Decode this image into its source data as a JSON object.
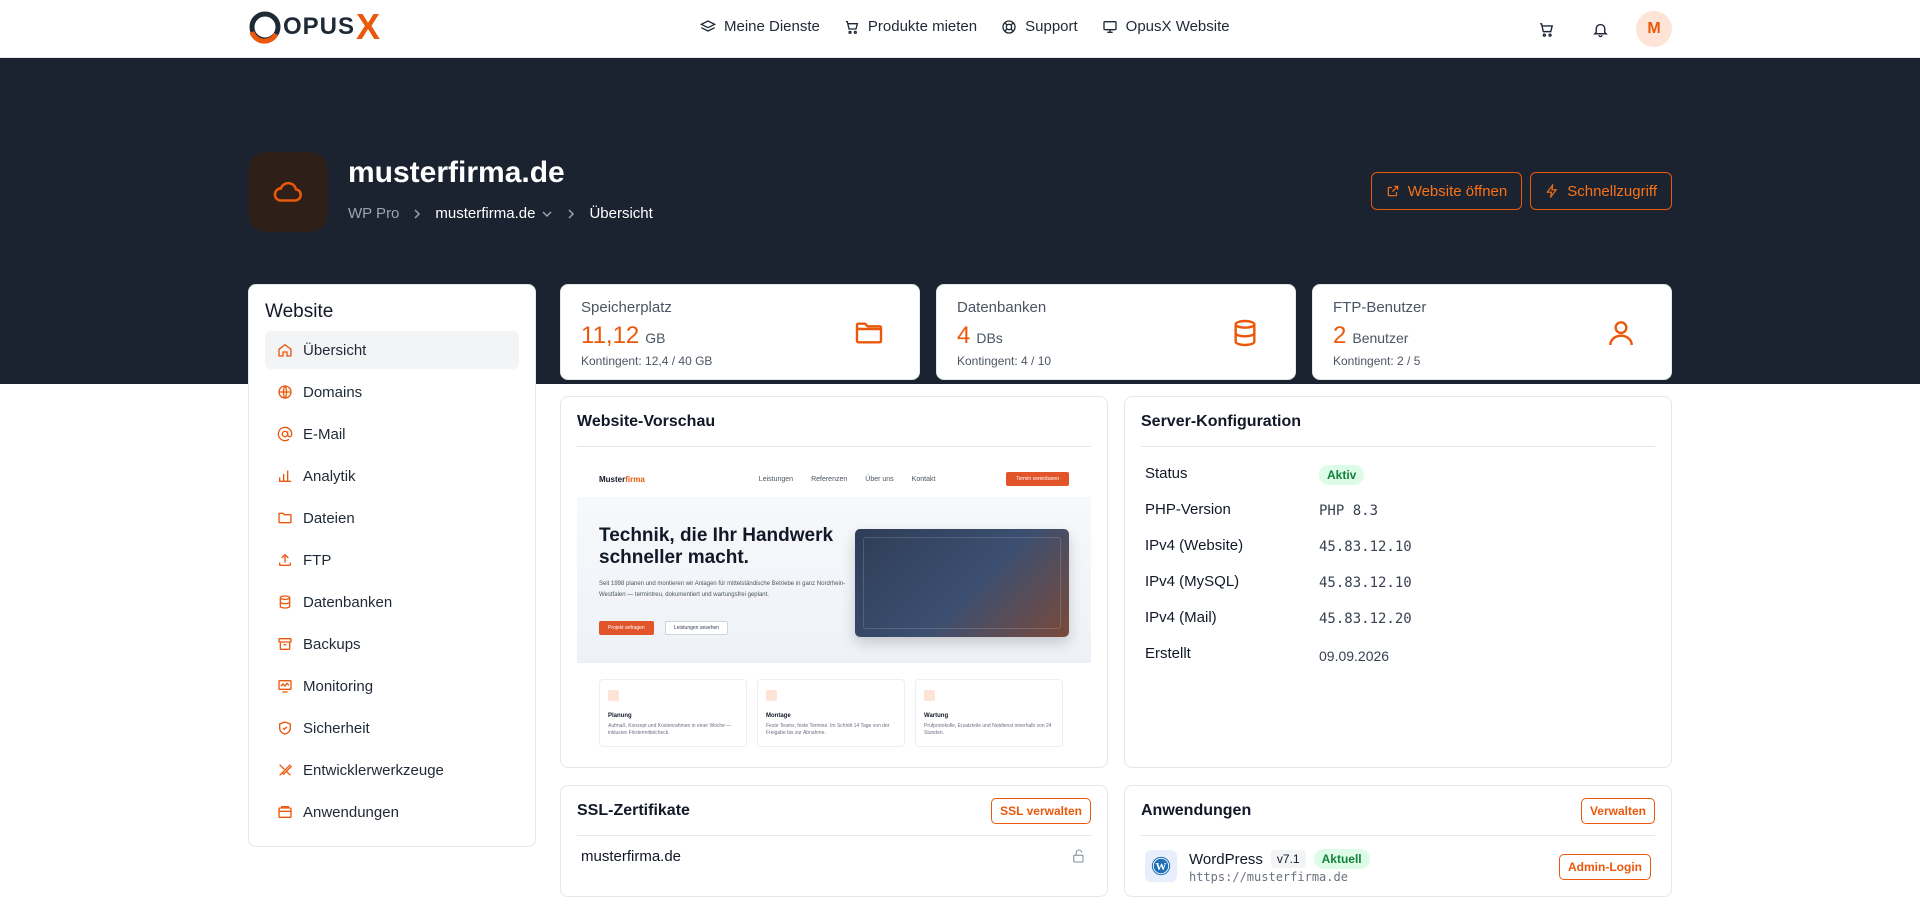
{
  "brand": {
    "logo_text_main": "OPUS",
    "logo_text_x": "X"
  },
  "topnav": {
    "items": [
      {
        "label": "Meine Dienste",
        "icon": "layers-icon"
      },
      {
        "label": "Produkte mieten",
        "icon": "cart-icon"
      },
      {
        "label": "Support",
        "icon": "lifebuoy-icon"
      },
      {
        "label": "OpusX Website",
        "icon": "monitor-icon"
      }
    ],
    "avatar_initial": "M"
  },
  "header": {
    "title": "musterfirma.de",
    "breadcrumb": {
      "root": "WP Pro",
      "site": "musterfirma.de",
      "page": "Übersicht"
    },
    "open_website_label": "Website öffnen",
    "quick_access_label": "Schnellzugriff"
  },
  "sidebar": {
    "title": "Website",
    "items": [
      {
        "label": "Übersicht",
        "icon": "home-icon",
        "active": true
      },
      {
        "label": "Domains",
        "icon": "globe-icon"
      },
      {
        "label": "E-Mail",
        "icon": "at-icon"
      },
      {
        "label": "Analytik",
        "icon": "bar-chart-icon"
      },
      {
        "label": "Dateien",
        "icon": "folder-icon"
      },
      {
        "label": "FTP",
        "icon": "upload-icon"
      },
      {
        "label": "Datenbanken",
        "icon": "database-icon"
      },
      {
        "label": "Backups",
        "icon": "archive-icon"
      },
      {
        "label": "Monitoring",
        "icon": "activity-icon"
      },
      {
        "label": "Sicherheit",
        "icon": "shield-icon"
      },
      {
        "label": "Entwicklerwerkzeuge",
        "icon": "tools-icon"
      },
      {
        "label": "Anwendungen",
        "icon": "app-window-icon"
      }
    ]
  },
  "stats": [
    {
      "label": "Speicherplatz",
      "value": "11,12",
      "unit": "GB",
      "quota": "Kontingent: 12,4 / 40 GB",
      "icon": "folder-icon"
    },
    {
      "label": "Datenbanken",
      "value": "4",
      "unit": "DBs",
      "quota": "Kontingent: 4 / 10",
      "icon": "database-icon"
    },
    {
      "label": "FTP-Benutzer",
      "value": "2",
      "unit": "Benutzer",
      "quota": "Kontingent: 2 / 5",
      "icon": "user-icon"
    }
  ],
  "preview": {
    "title": "Website-Vorschau",
    "brand_main": "Muster",
    "brand_accent": "firma",
    "links": [
      "Leistungen",
      "Referenzen",
      "Über uns",
      "Kontakt"
    ],
    "cta": "Termin vereinbaren",
    "headline": "Technik, die Ihr Handwerk schneller macht.",
    "text": "Seit 1998 planen und montieren wir Anlagen für mittelständische Betriebe in ganz Nordrhein-Westfalen — termintreu, dokumentiert und wartungsfrei geplant.",
    "btn_primary": "Projekt anfragen",
    "btn_secondary": "Leistungen ansehen",
    "cards": [
      {
        "title": "Planung",
        "text": "Aufmaß, Konzept und Kostenrahmen in einer Woche — inklusive Fördermittelcheck."
      },
      {
        "title": "Montage",
        "text": "Feste Teams, feste Termine. Im Schnitt 14 Tage von der Freigabe bis zur Abnahme."
      },
      {
        "title": "Wartung",
        "text": "Prüfprotokolle, Ersatzteile und Notdienst innerhalb von 24 Stunden."
      }
    ]
  },
  "server": {
    "title": "Server-Konfiguration",
    "rows": [
      {
        "label": "Status",
        "value": "Aktiv"
      },
      {
        "label": "PHP-Version",
        "value": "PHP 8.3"
      },
      {
        "label": "IPv4 (Website)",
        "value": "45.83.12.10"
      },
      {
        "label": "IPv4 (MySQL)",
        "value": "45.83.12.10"
      },
      {
        "label": "IPv4 (Mail)",
        "value": "45.83.12.20"
      },
      {
        "label": "Erstellt",
        "value": "09.09.2026"
      }
    ]
  },
  "ssl": {
    "title": "SSL-Zertifikate",
    "manage_label": "SSL verwalten",
    "domain": "musterfirma.de"
  },
  "apps": {
    "title": "Anwendungen",
    "manage_label": "Verwalten",
    "item": {
      "name": "WordPress",
      "version": "v7.1",
      "status": "Aktuell",
      "url": "https://musterfirma.de",
      "admin_label": "Admin-Login"
    }
  },
  "colors": {
    "accent": "#ea580c",
    "hero_bg": "#1b2230",
    "success": "#15803d"
  }
}
